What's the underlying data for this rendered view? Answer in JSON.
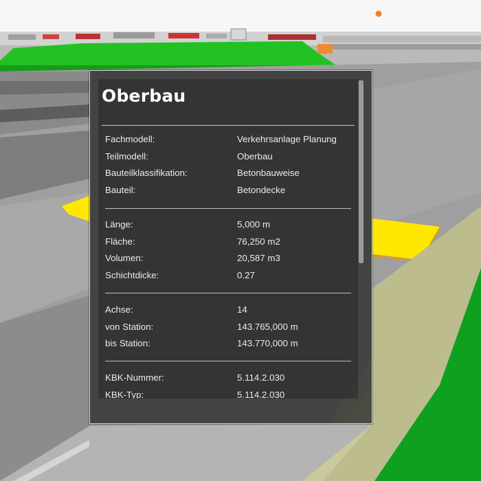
{
  "panel": {
    "title": "Oberbau",
    "sections": [
      {
        "rows": [
          {
            "label": "Fachmodell:",
            "value": "Verkehrsanlage Planung"
          },
          {
            "label": "Teilmodell:",
            "value": "Oberbau"
          },
          {
            "label": "Bauteilklassifikation:",
            "value": "Betonbauweise"
          },
          {
            "label": "Bauteil:",
            "value": "Betondecke"
          }
        ]
      },
      {
        "rows": [
          {
            "label": "Länge:",
            "value": "5,000 m"
          },
          {
            "label": "Fläche:",
            "value": "76,250 m2"
          },
          {
            "label": "Volumen:",
            "value": "20,587 m3"
          },
          {
            "label": "Schichtdicke:",
            "value": "0.27"
          }
        ]
      },
      {
        "rows": [
          {
            "label": "Achse:",
            "value": "14"
          },
          {
            "label": "von Station:",
            "value": "143.765,000 m"
          },
          {
            "label": "bis Station:",
            "value": "143.770,000 m"
          }
        ]
      },
      {
        "rows": [
          {
            "label": "KBK-Nummer:",
            "value": "5.114.2.030"
          },
          {
            "label": "KBK-Typ:",
            "value": "5.114.2.030"
          }
        ]
      }
    ]
  },
  "colors": {
    "embankment_green": "#22c222",
    "grass_green": "#0fa01f",
    "highlight_yellow": "#ffe800",
    "marker_orange": "#f5821f"
  }
}
